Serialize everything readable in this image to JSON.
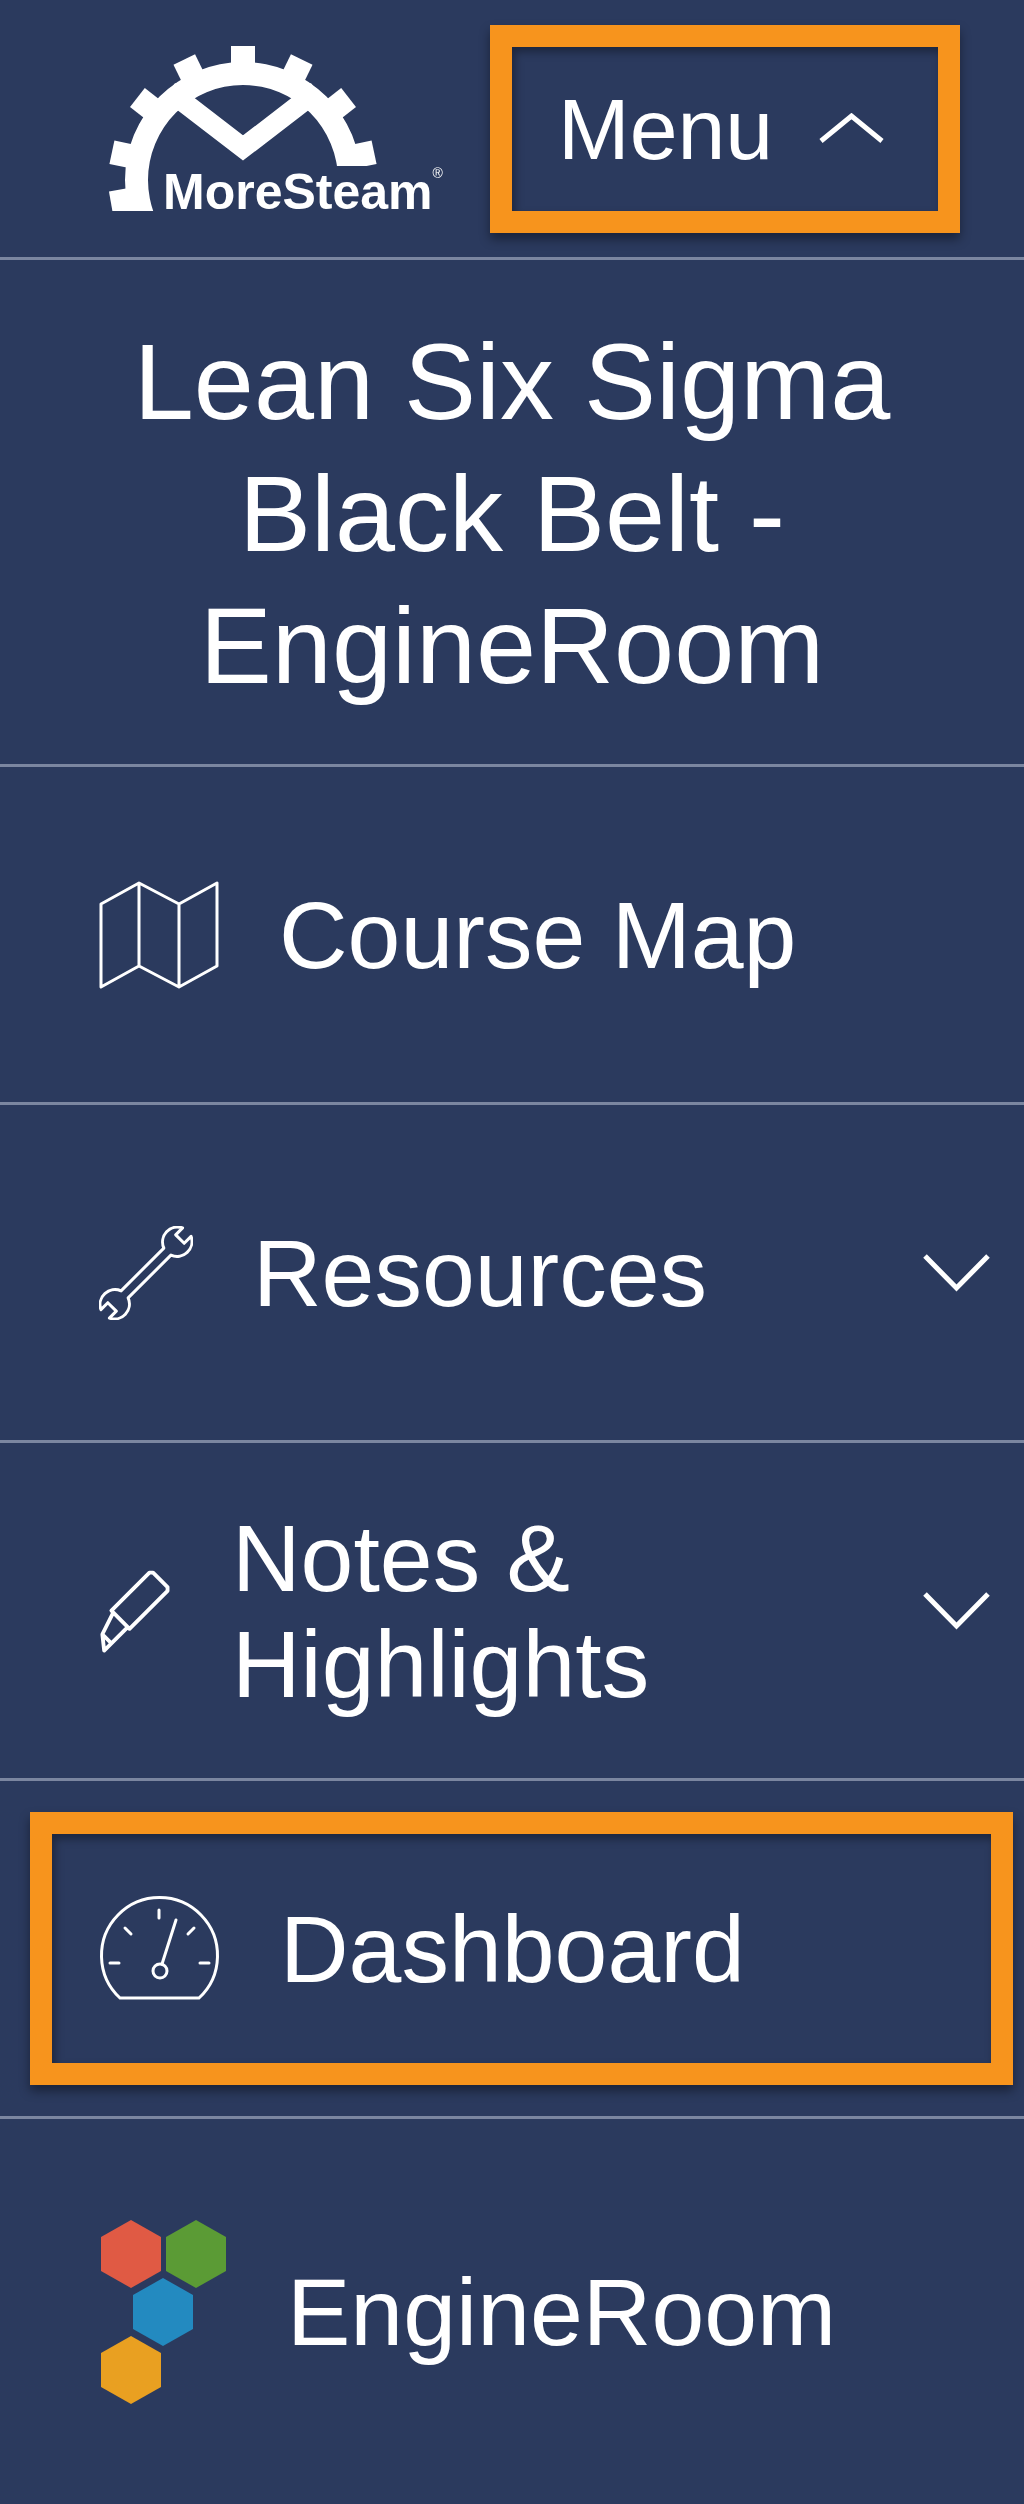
{
  "header": {
    "logo_text": "MoreSteam$^{®}$",
    "menu_button": {
      "label": "Menu",
      "expanded": true,
      "highlighted": true
    }
  },
  "course_title": "Lean Six Sigma Black Belt - EngineRoom",
  "nav_items": [
    {
      "kind": "link",
      "label": "Course Map",
      "highlighted": false
    },
    {
      "kind": "dropdown",
      "label": "Resources",
      "expanded": false,
      "highlighted": false
    },
    {
      "kind": "dropdown",
      "label": "Notes & Highlights",
      "expanded": false,
      "highlighted": false
    },
    {
      "kind": "link",
      "label": "Dashboard",
      "highlighted": true
    },
    {
      "kind": "link",
      "label": "EngineRoom",
      "highlighted": false
    }
  ]
}
